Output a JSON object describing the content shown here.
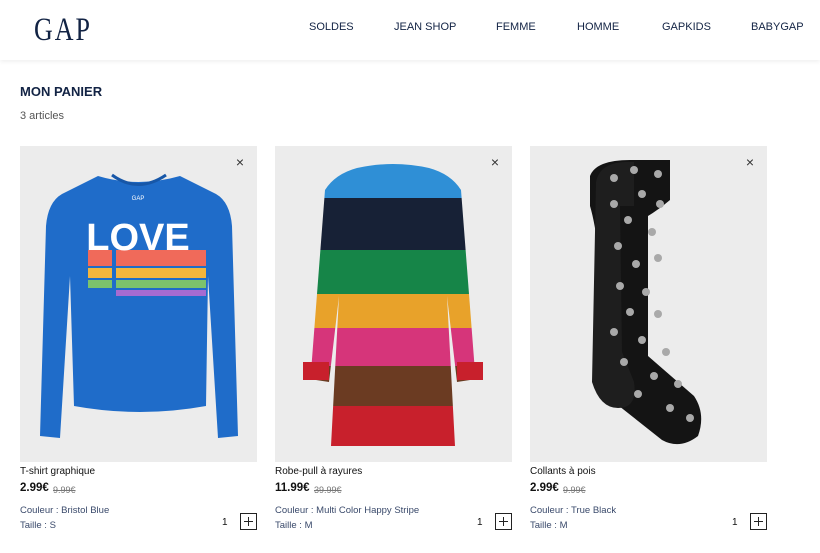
{
  "header": {
    "logo": "GAP",
    "nav": [
      "SOLDES",
      "JEAN SHOP",
      "FEMME",
      "HOMME",
      "GAPKIDS",
      "BABYGAP"
    ]
  },
  "cart": {
    "title": "MON PANIER",
    "count": "3 articles"
  },
  "items": [
    {
      "name": "T-shirt graphique",
      "price": "2.99€",
      "old_price": "9.99€",
      "color": "Couleur : Bristol Blue",
      "size": "Taille : S",
      "qty": "1",
      "graphic_text": "LOVE",
      "close_icon": "×"
    },
    {
      "name": "Robe-pull à rayures",
      "price": "11.99€",
      "old_price": "39.99€",
      "color": "Couleur : Multi Color Happy Stripe",
      "size": "Taille : M",
      "qty": "1",
      "close_icon": "×"
    },
    {
      "name": "Collants à pois",
      "price": "2.99€",
      "old_price": "9.99€",
      "color": "Couleur : True Black",
      "size": "Taille : M",
      "qty": "1",
      "close_icon": "×"
    }
  ],
  "colors": {
    "brand_navy": "#122344",
    "shirt_blue": "#1f6cc9",
    "card_bg": "#ececec"
  }
}
